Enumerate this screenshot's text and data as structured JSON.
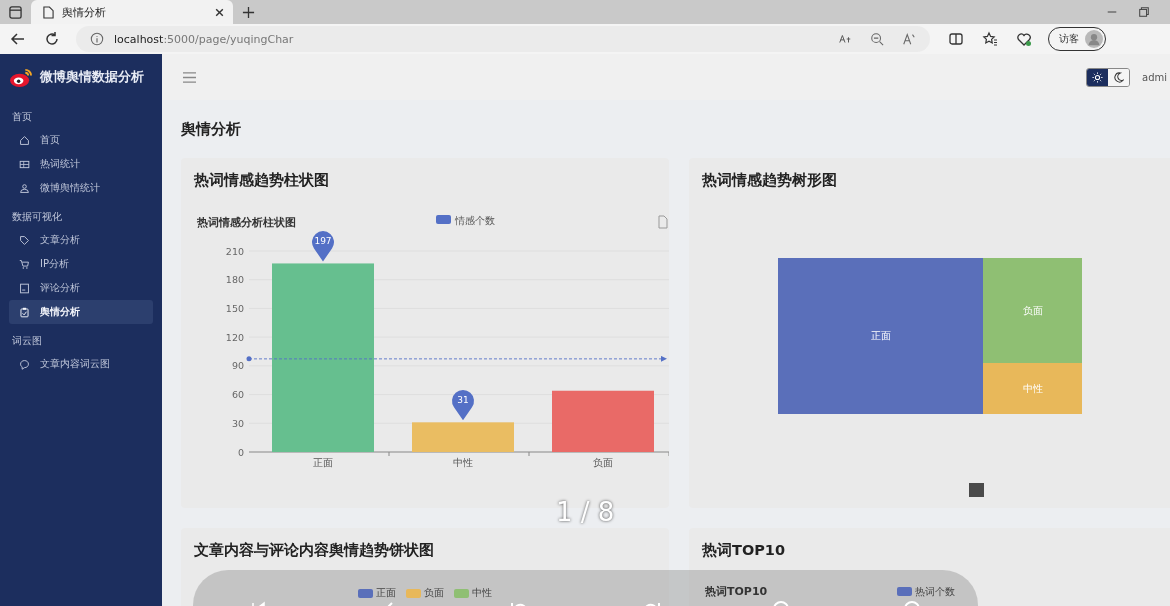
{
  "browser": {
    "tab_title": "舆情分析",
    "url_host": "localhost",
    "url_path": ":5000/page/yuqingChar",
    "profile_label": "访客"
  },
  "sidebar": {
    "brand": "微博舆情数据分析",
    "sections": [
      {
        "label": "首页",
        "items": [
          {
            "label": "首页",
            "selected": false
          },
          {
            "label": "热词统计",
            "selected": false
          },
          {
            "label": "微博舆情统计",
            "selected": false
          }
        ]
      },
      {
        "label": "数据可视化",
        "items": [
          {
            "label": "文章分析",
            "selected": false
          },
          {
            "label": "IP分析",
            "selected": false
          },
          {
            "label": "评论分析",
            "selected": false
          },
          {
            "label": "舆情分析",
            "selected": true
          }
        ]
      },
      {
        "label": "词云图",
        "items": [
          {
            "label": "文章内容词云图",
            "selected": false
          }
        ]
      }
    ]
  },
  "header": {
    "theme_options": [
      {
        "kind": "light",
        "selected": true
      },
      {
        "kind": "dark",
        "selected": false
      }
    ],
    "user": "admi"
  },
  "page_title": "舆情分析",
  "bar_card": {
    "title": "热词情感趋势柱状图",
    "legend_swatch": {
      "color": "#5470c6"
    },
    "bars": [
      {
        "color": "#66bf8f"
      },
      {
        "color": "#eabd62"
      },
      {
        "color": "#e96a67"
      }
    ],
    "chart_data": {
      "type": "bar",
      "title": "热词情感分析柱状图",
      "categories": [
        "正面",
        "中性",
        "负面"
      ],
      "series": [
        {
          "name": "情感个数",
          "values": [
            197,
            31,
            64
          ]
        }
      ],
      "ylim": [
        0,
        210
      ],
      "yticks": [
        0,
        30,
        60,
        90,
        120,
        150,
        180,
        210
      ],
      "grid": true,
      "annotations": [
        {
          "text": "197",
          "x": "正面",
          "y": 197
        },
        {
          "text": "31",
          "x": "中性",
          "y": 31
        }
      ],
      "ref_lines": [
        {
          "axis": "y",
          "value": 97.3
        }
      ]
    }
  },
  "treemap_card": {
    "title": "热词情感趋势树形图",
    "items": [
      {
        "label": "正面",
        "color": "#5a6fba"
      },
      {
        "label": "负面",
        "color": "#8fbf73"
      },
      {
        "label": "中性",
        "color": "#e8b85a"
      }
    ]
  },
  "pie_card": {
    "title": "文章内容与评论内容舆情趋势饼状图",
    "legend": [
      {
        "label": "正面",
        "color": "#5a6fba"
      },
      {
        "label": "负面",
        "color": "#e8b85a"
      },
      {
        "label": "中性",
        "color": "#8fbf73"
      }
    ]
  },
  "top_card": {
    "title": "热词TOP10",
    "chart_title": "热词TOP10",
    "legend": [
      {
        "label": "热词个数",
        "color": "#5a6fba"
      }
    ]
  },
  "viewer_overlay": {
    "counter": "1 / 8"
  }
}
